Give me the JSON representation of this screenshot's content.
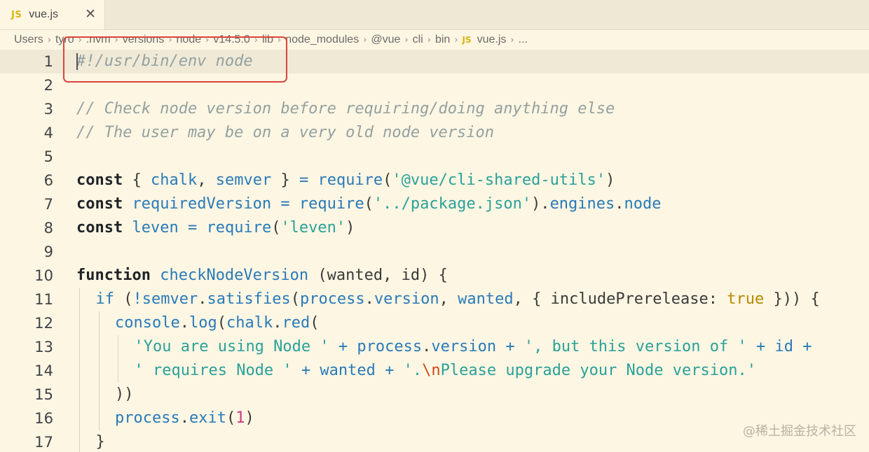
{
  "tab": {
    "badge": "JS",
    "title": "vue.js",
    "close_glyph": "✕"
  },
  "breadcrumb": {
    "items": [
      "Users",
      "tyro",
      ".nvm",
      "versions",
      "node",
      "v14.5.0",
      "lib",
      "node_modules",
      "@vue",
      "cli",
      "bin"
    ],
    "file_badge": "JS",
    "file": "vue.js",
    "trailing": "...",
    "separator": "›"
  },
  "editor": {
    "current_line": 1,
    "lines": [
      {
        "n": "1",
        "indent": 0,
        "tokens": [
          {
            "t": "#!/usr/bin/env node",
            "k": "cm"
          }
        ]
      },
      {
        "n": "2",
        "indent": 0,
        "tokens": []
      },
      {
        "n": "3",
        "indent": 0,
        "tokens": [
          {
            "t": "// Check node version before requiring/doing anything else",
            "k": "cm"
          }
        ]
      },
      {
        "n": "4",
        "indent": 0,
        "tokens": [
          {
            "t": "// The user may be on a very old node version",
            "k": "cm"
          }
        ]
      },
      {
        "n": "5",
        "indent": 0,
        "tokens": []
      },
      {
        "n": "6",
        "indent": 0,
        "tokens": [
          {
            "t": "const",
            "k": "kw"
          },
          {
            "t": " { ",
            "k": "pl"
          },
          {
            "t": "chalk",
            "k": "id"
          },
          {
            "t": ", ",
            "k": "pl"
          },
          {
            "t": "semver",
            "k": "id"
          },
          {
            "t": " } ",
            "k": "pl"
          },
          {
            "t": "=",
            "k": "id"
          },
          {
            "t": " ",
            "k": "pl"
          },
          {
            "t": "require",
            "k": "id"
          },
          {
            "t": "(",
            "k": "pl"
          },
          {
            "t": "'@vue/cli-shared-utils'",
            "k": "str"
          },
          {
            "t": ")",
            "k": "pl"
          }
        ]
      },
      {
        "n": "7",
        "indent": 0,
        "tokens": [
          {
            "t": "const",
            "k": "kw"
          },
          {
            "t": " ",
            "k": "pl"
          },
          {
            "t": "requiredVersion",
            "k": "id"
          },
          {
            "t": " ",
            "k": "pl"
          },
          {
            "t": "=",
            "k": "id"
          },
          {
            "t": " ",
            "k": "pl"
          },
          {
            "t": "require",
            "k": "id"
          },
          {
            "t": "(",
            "k": "pl"
          },
          {
            "t": "'../package.json'",
            "k": "str"
          },
          {
            "t": ").",
            "k": "pl"
          },
          {
            "t": "engines",
            "k": "id"
          },
          {
            "t": ".",
            "k": "pl"
          },
          {
            "t": "node",
            "k": "id"
          }
        ]
      },
      {
        "n": "8",
        "indent": 0,
        "tokens": [
          {
            "t": "const",
            "k": "kw"
          },
          {
            "t": " ",
            "k": "pl"
          },
          {
            "t": "leven",
            "k": "id"
          },
          {
            "t": " ",
            "k": "pl"
          },
          {
            "t": "=",
            "k": "id"
          },
          {
            "t": " ",
            "k": "pl"
          },
          {
            "t": "require",
            "k": "id"
          },
          {
            "t": "(",
            "k": "pl"
          },
          {
            "t": "'leven'",
            "k": "str"
          },
          {
            "t": ")",
            "k": "pl"
          }
        ]
      },
      {
        "n": "9",
        "indent": 0,
        "tokens": []
      },
      {
        "n": "10",
        "indent": 0,
        "tokens": [
          {
            "t": "function",
            "k": "kw"
          },
          {
            "t": " ",
            "k": "pl"
          },
          {
            "t": "checkNodeVersion",
            "k": "id"
          },
          {
            "t": " (wanted, id) {",
            "k": "pl"
          }
        ]
      },
      {
        "n": "11",
        "indent": 1,
        "tokens": [
          {
            "t": "if",
            "k": "id"
          },
          {
            "t": " (",
            "k": "pl"
          },
          {
            "t": "!",
            "k": "id"
          },
          {
            "t": "semver",
            "k": "id"
          },
          {
            "t": ".",
            "k": "pl"
          },
          {
            "t": "satisfies",
            "k": "id"
          },
          {
            "t": "(",
            "k": "pl"
          },
          {
            "t": "process",
            "k": "id"
          },
          {
            "t": ".",
            "k": "pl"
          },
          {
            "t": "version",
            "k": "id"
          },
          {
            "t": ", ",
            "k": "pl"
          },
          {
            "t": "wanted",
            "k": "id"
          },
          {
            "t": ", { includePrerelease: ",
            "k": "pl"
          },
          {
            "t": "true",
            "k": "bool"
          },
          {
            "t": " })) {",
            "k": "pl"
          }
        ]
      },
      {
        "n": "12",
        "indent": 2,
        "tokens": [
          {
            "t": "console",
            "k": "id"
          },
          {
            "t": ".",
            "k": "pl"
          },
          {
            "t": "log",
            "k": "id"
          },
          {
            "t": "(",
            "k": "pl"
          },
          {
            "t": "chalk",
            "k": "id"
          },
          {
            "t": ".",
            "k": "pl"
          },
          {
            "t": "red",
            "k": "id"
          },
          {
            "t": "(",
            "k": "pl"
          }
        ]
      },
      {
        "n": "13",
        "indent": 3,
        "tokens": [
          {
            "t": "'You are using Node '",
            "k": "str"
          },
          {
            "t": " ",
            "k": "pl"
          },
          {
            "t": "+",
            "k": "id"
          },
          {
            "t": " ",
            "k": "pl"
          },
          {
            "t": "process",
            "k": "id"
          },
          {
            "t": ".",
            "k": "pl"
          },
          {
            "t": "version",
            "k": "id"
          },
          {
            "t": " ",
            "k": "pl"
          },
          {
            "t": "+",
            "k": "id"
          },
          {
            "t": " ",
            "k": "pl"
          },
          {
            "t": "', but this version of '",
            "k": "str"
          },
          {
            "t": " ",
            "k": "pl"
          },
          {
            "t": "+",
            "k": "id"
          },
          {
            "t": " ",
            "k": "pl"
          },
          {
            "t": "id",
            "k": "id"
          },
          {
            "t": " ",
            "k": "pl"
          },
          {
            "t": "+",
            "k": "id"
          }
        ]
      },
      {
        "n": "14",
        "indent": 3,
        "tokens": [
          {
            "t": "' requires Node '",
            "k": "str"
          },
          {
            "t": " ",
            "k": "pl"
          },
          {
            "t": "+",
            "k": "id"
          },
          {
            "t": " ",
            "k": "pl"
          },
          {
            "t": "wanted",
            "k": "id"
          },
          {
            "t": " ",
            "k": "pl"
          },
          {
            "t": "+",
            "k": "id"
          },
          {
            "t": " ",
            "k": "pl"
          },
          {
            "t": "'.",
            "k": "str"
          },
          {
            "t": "\\n",
            "k": "esc"
          },
          {
            "t": "Please upgrade your Node version.'",
            "k": "str"
          }
        ]
      },
      {
        "n": "15",
        "indent": 2,
        "tokens": [
          {
            "t": "))",
            "k": "pl"
          }
        ]
      },
      {
        "n": "16",
        "indent": 2,
        "tokens": [
          {
            "t": "process",
            "k": "id"
          },
          {
            "t": ".",
            "k": "pl"
          },
          {
            "t": "exit",
            "k": "id"
          },
          {
            "t": "(",
            "k": "pl"
          },
          {
            "t": "1",
            "k": "num"
          },
          {
            "t": ")",
            "k": "pl"
          }
        ]
      },
      {
        "n": "17",
        "indent": 1,
        "tokens": [
          {
            "t": "}",
            "k": "pl"
          }
        ]
      }
    ]
  },
  "watermark": "@稀土掘金技术社区",
  "colors": {
    "background": "#fdf6e3",
    "comment": "#93a1a1",
    "identifier": "#2a7ab8",
    "string": "#2aa198",
    "highlight_box": "#d9443b"
  }
}
